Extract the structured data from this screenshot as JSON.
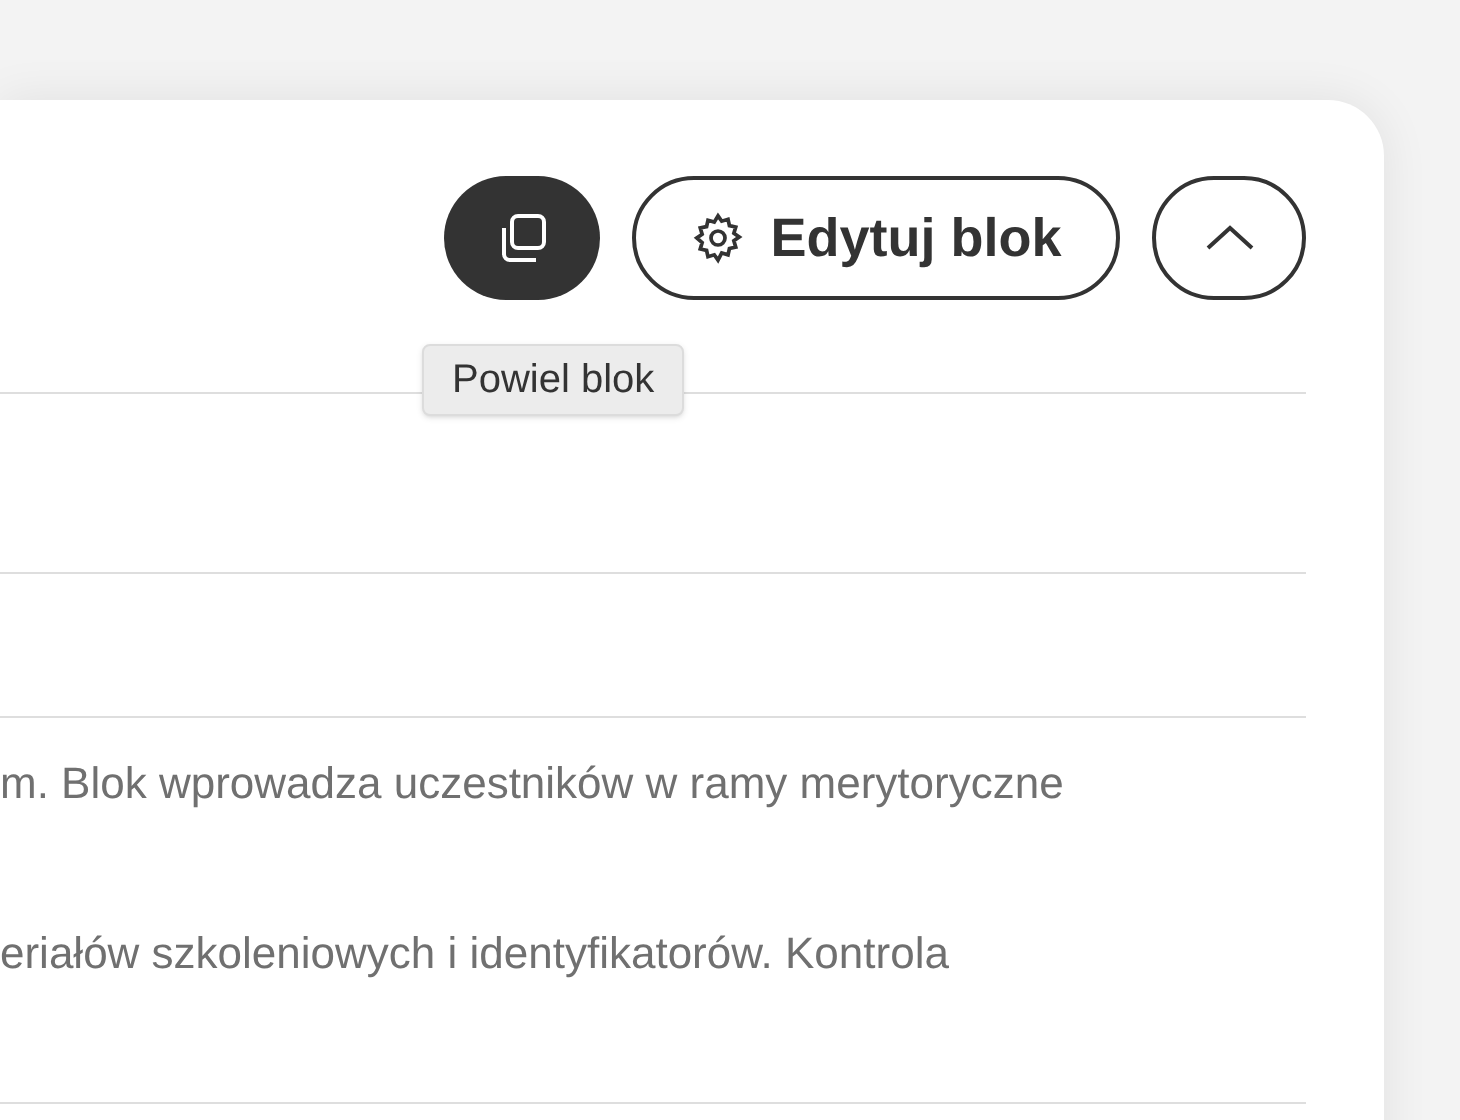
{
  "toolbar": {
    "duplicate_button": {
      "tooltip": "Powiel blok"
    },
    "edit_button": {
      "label": "Edytuj blok"
    }
  },
  "description": [
    "m. Blok wprowadza uczestników w ramy merytoryczne",
    "eriałów szkoleniowych i identyfikatorów. Kontrola"
  ]
}
